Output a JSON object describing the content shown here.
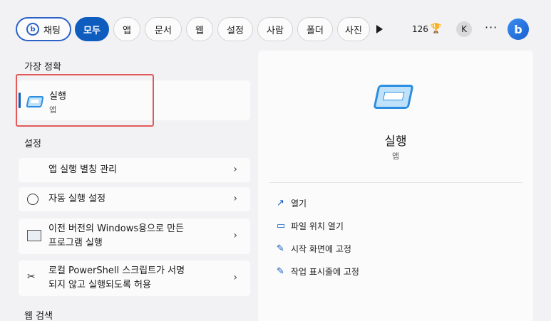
{
  "filters": {
    "chat_label": "채팅",
    "chat_badge": "b",
    "tabs": [
      "모두",
      "앱",
      "문서",
      "웹",
      "설정",
      "사람",
      "폴더",
      "사진"
    ],
    "points": "126",
    "avatar_initial": "K",
    "more": "···",
    "bing_badge": "b"
  },
  "best_match": {
    "heading": "가장 정확",
    "title": "실행",
    "subtitle": "앱"
  },
  "settings": {
    "heading": "설정",
    "items": [
      {
        "line1": "앱 실행 별칭 관리",
        "line2": ""
      },
      {
        "line1": "자동 실행 설정",
        "line2": ""
      },
      {
        "line1": "이전 버전의 Windows용으로 만든",
        "line2": "프로그램 실행"
      },
      {
        "line1": "로컬 PowerShell 스크립트가 서명",
        "line2": "되지 않고 실행되도록 허용"
      }
    ]
  },
  "web_search": {
    "heading": "웹 검색"
  },
  "detail": {
    "title": "실행",
    "subtitle": "앱",
    "actions": [
      {
        "label": "열기",
        "icon": "open-icon"
      },
      {
        "label": "파일 위치 열기",
        "icon": "folder-icon"
      },
      {
        "label": "시작 화면에 고정",
        "icon": "pin-icon"
      },
      {
        "label": "작업 표시줄에 고정",
        "icon": "pin-icon"
      }
    ]
  },
  "colors": {
    "accent": "#0f5cbf",
    "highlight": "#e05a5a"
  }
}
